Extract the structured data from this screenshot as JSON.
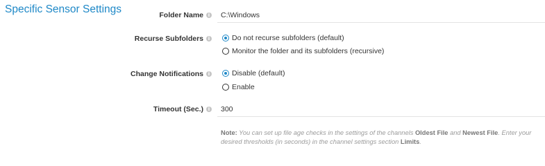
{
  "section": {
    "title": "Specific Sensor Settings"
  },
  "folder_name": {
    "label": "Folder Name",
    "value": "C:\\Windows"
  },
  "recurse_subfolders": {
    "label": "Recurse Subfolders",
    "options": [
      {
        "label": "Do not recurse subfolders (default)",
        "checked": true
      },
      {
        "label": "Monitor the folder and its subfolders (recursive)",
        "checked": false
      }
    ]
  },
  "change_notifications": {
    "label": "Change Notifications",
    "options": [
      {
        "label": "Disable (default)",
        "checked": true
      },
      {
        "label": "Enable",
        "checked": false
      }
    ]
  },
  "timeout": {
    "label": "Timeout (Sec.)",
    "value": "300"
  },
  "note": {
    "prefix": "Note:",
    "text1": " You can set up file age checks in the settings of the channels ",
    "oldest": "Oldest File",
    "and": " and ",
    "newest": "Newest File",
    "text2": ". Enter your desired thresholds (in seconds) in the channel settings section ",
    "limits": "Limits",
    "end": "."
  },
  "info_icon": "info-icon",
  "colors": {
    "accent": "#1e88c7",
    "label": "#333333",
    "note": "#9b9b9b"
  }
}
